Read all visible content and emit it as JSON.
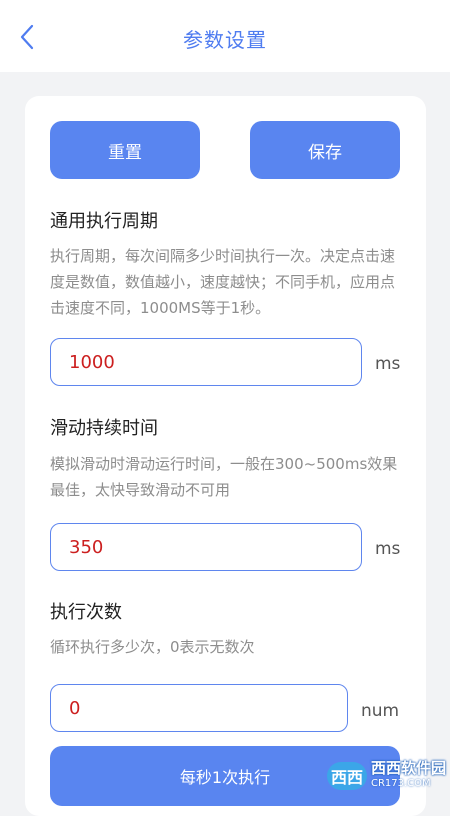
{
  "header": {
    "title": "参数设置",
    "back_icon": "chevron-left-icon"
  },
  "actions": {
    "reset_label": "重置",
    "save_label": "保存"
  },
  "sections": {
    "period": {
      "title": "通用执行周期",
      "description": "执行周期，每次间隔多少时间执行一次。决定点击速度是数值，数值越小，速度越快；不同手机，应用点击速度不同，1000MS等于1秒。",
      "value": "1000",
      "unit": "ms"
    },
    "swipe": {
      "title": "滑动持续时间",
      "description": "模拟滑动时滑动运行时间，一般在300~500ms效果最佳，太快导致滑动不可用",
      "value": "350",
      "unit": "ms"
    },
    "count": {
      "title": "执行次数",
      "description": "循环执行多少次，0表示无数次",
      "value": "0",
      "unit": "num"
    }
  },
  "bottom_button": {
    "label": "每秒1次执行"
  },
  "watermark": {
    "logo": "西西",
    "name": "西西软件园",
    "sub": "CR173.COM"
  },
  "colors": {
    "accent": "#5985f0",
    "title": "#4f7cf0",
    "value": "#cc1f1f",
    "background": "#f2f3f5"
  }
}
